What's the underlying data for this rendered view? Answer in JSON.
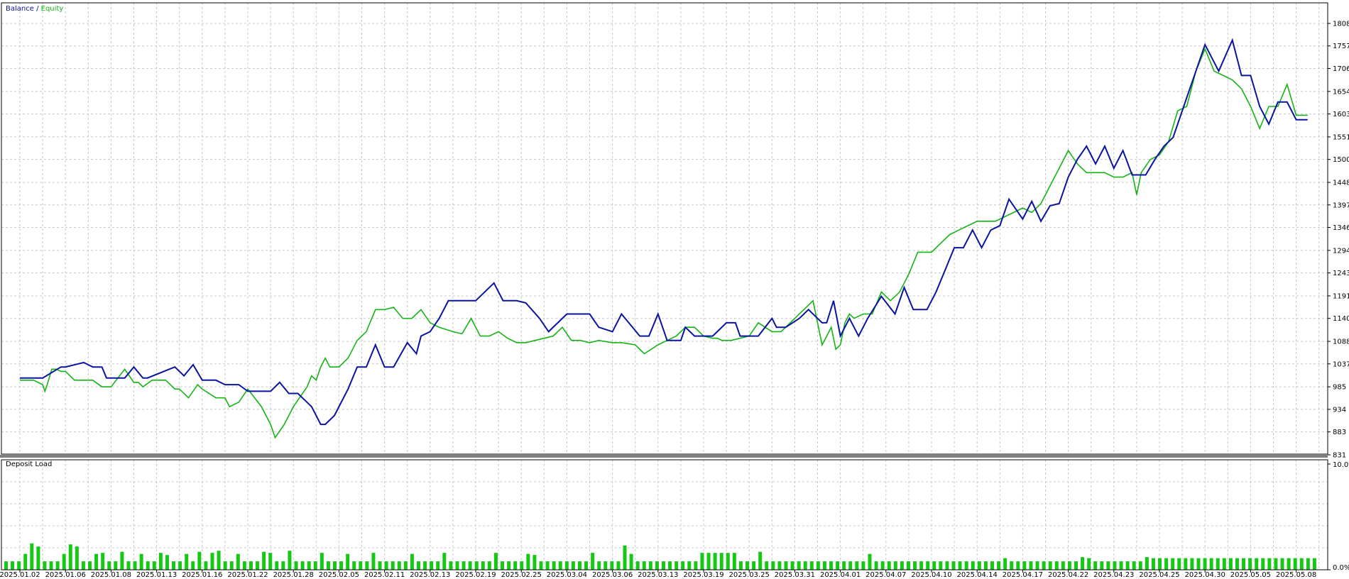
{
  "colors": {
    "balance": "#0a14a0",
    "equity": "#14b414",
    "deposit_bar": "#14c814",
    "grid": "#c8c8c8",
    "frame": "#000000",
    "separator": "#7f7f7f",
    "background": "#ffffff"
  },
  "chart_data": [
    {
      "type": "line",
      "legend": [
        "Balance",
        "Equity"
      ],
      "legend_separator": " / ",
      "legend_placement": "top-left",
      "grid": true,
      "y_axis_side": "right",
      "ylim": [
        831,
        1808
      ],
      "y_ticks": [
        831,
        883,
        934,
        985,
        1037,
        1088,
        1140,
        1191,
        1243,
        1294,
        1346,
        1397,
        1448,
        1500,
        1551,
        1603,
        1654,
        1706,
        1757,
        1808
      ],
      "x_ticks": [
        "2025.01.02",
        "2025.01.06",
        "2025.01.08",
        "2025.01.13",
        "2025.01.16",
        "2025.01.22",
        "2025.01.28",
        "2025.02.05",
        "2025.02.11",
        "2025.02.13",
        "2025.02.19",
        "2025.02.25",
        "2025.03.04",
        "2025.03.06",
        "2025.03.13",
        "2025.03.19",
        "2025.03.25",
        "2025.03.31",
        "2025.04.01",
        "2025.04.07",
        "2025.04.10",
        "2025.04.14",
        "2025.04.17",
        "2025.04.22",
        "2025.04.23",
        "2025.04.25",
        "2025.04.30",
        "2025.05.05",
        "2025.05.08"
      ],
      "series": [
        {
          "name": "Balance",
          "x": [
            0,
            0.5,
            0.9,
            1.0,
            1.4,
            1.6,
            1.8,
            1.9,
            2.3,
            2.5,
            2.7,
            2.8,
            3.4,
            3.6,
            3.8,
            4.0,
            4.3,
            4.5,
            4.8,
            5.0,
            5.5,
            5.7,
            5.9,
            6.1,
            6.4,
            6.6,
            6.7,
            6.9,
            7.2,
            7.4,
            7.6,
            7.8,
            8.0,
            8.2,
            8.5,
            8.7,
            8.8,
            9.0,
            9.2,
            9.4,
            9.6,
            10.0,
            10.4,
            10.6,
            10.9,
            11.1,
            11.4,
            11.6,
            12.0,
            12.5,
            12.7,
            13.0,
            13.2,
            13.6,
            13.8,
            14.0,
            14.2,
            14.5,
            14.6,
            14.8,
            15.2,
            15.5,
            15.7,
            15.8,
            16.2,
            16.5,
            16.6,
            16.8,
            17.1,
            17.3,
            17.6,
            17.7,
            17.85,
            18.0,
            18.2,
            18.4,
            18.6,
            18.9,
            19.2,
            19.4,
            19.6,
            19.9,
            20.1,
            20.3,
            20.5,
            20.7,
            20.9,
            21.1,
            21.3,
            21.5,
            21.7,
            22.0,
            22.2,
            22.4,
            22.6,
            22.8,
            23.0,
            23.2,
            23.4,
            23.6,
            23.8,
            24.0,
            24.2,
            24.4,
            24.7,
            24.9,
            25.1,
            25.3,
            25.6,
            25.8,
            26.0,
            26.3,
            26.6,
            26.8,
            27.0,
            27.2,
            27.4,
            27.6,
            27.8,
            28.0,
            28.25
          ],
          "values": [
            1005,
            1005,
            1030,
            1030,
            1040,
            1030,
            1030,
            1005,
            1005,
            1030,
            1005,
            1005,
            1030,
            1010,
            1035,
            1000,
            1000,
            990,
            990,
            975,
            975,
            995,
            970,
            970,
            940,
            900,
            900,
            920,
            980,
            1030,
            1030,
            1080,
            1030,
            1030,
            1085,
            1060,
            1100,
            1110,
            1140,
            1180,
            1180,
            1180,
            1220,
            1180,
            1180,
            1175,
            1140,
            1110,
            1150,
            1150,
            1120,
            1110,
            1150,
            1100,
            1100,
            1150,
            1090,
            1090,
            1120,
            1100,
            1100,
            1130,
            1130,
            1100,
            1100,
            1140,
            1120,
            1120,
            1140,
            1160,
            1130,
            1130,
            1180,
            1100,
            1140,
            1100,
            1140,
            1190,
            1150,
            1210,
            1160,
            1160,
            1200,
            1250,
            1300,
            1300,
            1340,
            1300,
            1340,
            1350,
            1410,
            1365,
            1405,
            1360,
            1395,
            1400,
            1460,
            1500,
            1530,
            1490,
            1530,
            1480,
            1520,
            1465,
            1465,
            1500,
            1530,
            1550,
            1640,
            1700,
            1760,
            1700,
            1770,
            1690,
            1690,
            1620,
            1580,
            1630,
            1630,
            1590,
            1590
          ]
        },
        {
          "name": "Equity",
          "x": [
            0,
            0.3,
            0.5,
            0.55,
            0.6,
            0.7,
            0.8,
            0.9,
            1.0,
            1.2,
            1.6,
            1.8,
            2.0,
            2.3,
            2.5,
            2.6,
            2.7,
            2.9,
            3.2,
            3.4,
            3.5,
            3.7,
            3.9,
            4.0,
            4.3,
            4.5,
            4.6,
            4.8,
            5.0,
            5.3,
            5.5,
            5.6,
            5.8,
            6.0,
            6.3,
            6.4,
            6.5,
            6.6,
            6.7,
            6.8,
            7.0,
            7.2,
            7.4,
            7.6,
            7.8,
            8.0,
            8.2,
            8.4,
            8.6,
            8.8,
            9.0,
            9.2,
            9.5,
            9.7,
            9.9,
            10.1,
            10.3,
            10.5,
            10.7,
            10.9,
            11.1,
            11.3,
            11.5,
            11.7,
            11.9,
            12.1,
            12.3,
            12.5,
            12.7,
            13.0,
            13.2,
            13.5,
            13.7,
            14.0,
            14.2,
            14.4,
            14.6,
            14.8,
            15.0,
            15.2,
            15.3,
            15.4,
            15.6,
            15.8,
            16.0,
            16.2,
            16.5,
            16.7,
            17.0,
            17.2,
            17.4,
            17.6,
            17.8,
            17.9,
            18.0,
            18.1,
            18.2,
            18.3,
            18.5,
            18.7,
            18.9,
            19.1,
            19.3,
            19.5,
            19.7,
            20.0,
            20.2,
            20.4,
            20.6,
            20.8,
            21.0,
            21.2,
            21.4,
            21.6,
            21.8,
            22.0,
            22.2,
            22.4,
            22.6,
            22.8,
            23.0,
            23.2,
            23.4,
            23.6,
            23.8,
            24.0,
            24.2,
            24.4,
            24.5,
            24.6,
            24.8,
            25.0,
            25.2,
            25.4,
            25.6,
            25.8,
            26.0,
            26.2,
            26.4,
            26.6,
            26.8,
            27.0,
            27.2,
            27.4,
            27.6,
            27.8,
            28.0,
            28.25
          ],
          "values": [
            1000,
            1000,
            990,
            975,
            990,
            1025,
            1025,
            1020,
            1020,
            1000,
            1000,
            985,
            985,
            1025,
            995,
            995,
            985,
            1000,
            1000,
            980,
            980,
            960,
            990,
            980,
            960,
            960,
            940,
            950,
            980,
            940,
            900,
            870,
            900,
            940,
            985,
            1010,
            1000,
            1030,
            1050,
            1030,
            1030,
            1050,
            1090,
            1110,
            1160,
            1160,
            1165,
            1140,
            1140,
            1160,
            1130,
            1120,
            1110,
            1105,
            1140,
            1100,
            1100,
            1110,
            1095,
            1085,
            1085,
            1090,
            1095,
            1100,
            1120,
            1090,
            1090,
            1085,
            1090,
            1085,
            1085,
            1080,
            1060,
            1080,
            1090,
            1100,
            1120,
            1120,
            1100,
            1095,
            1095,
            1090,
            1090,
            1095,
            1100,
            1130,
            1110,
            1110,
            1140,
            1160,
            1180,
            1080,
            1120,
            1070,
            1080,
            1130,
            1150,
            1140,
            1150,
            1150,
            1200,
            1180,
            1200,
            1240,
            1290,
            1290,
            1310,
            1330,
            1340,
            1350,
            1360,
            1360,
            1360,
            1370,
            1380,
            1390,
            1380,
            1400,
            1440,
            1480,
            1520,
            1490,
            1470,
            1470,
            1470,
            1460,
            1460,
            1470,
            1420,
            1470,
            1500,
            1510,
            1540,
            1610,
            1620,
            1700,
            1750,
            1700,
            1690,
            1680,
            1660,
            1620,
            1570,
            1620,
            1620,
            1670,
            1600,
            1600
          ]
        }
      ]
    },
    {
      "type": "bar",
      "title": "Deposit Load",
      "y_axis_side": "right",
      "ylim": [
        0,
        10
      ],
      "y_ticks": [
        "10.0%",
        "0.0%"
      ],
      "unit": "%",
      "values": [
        0.8,
        0.8,
        0.8,
        1.5,
        2.5,
        2.2,
        0.8,
        0.8,
        0.8,
        1.5,
        2.4,
        2.2,
        0.8,
        0.8,
        1.5,
        1.6,
        0.8,
        0.8,
        1.7,
        0.8,
        0.8,
        1.5,
        0.8,
        0.8,
        1.6,
        1.4,
        0.8,
        0.8,
        1.5,
        0.8,
        1.7,
        0.8,
        1.6,
        1.8,
        0.8,
        0.8,
        1.5,
        0.8,
        0.8,
        0.8,
        1.7,
        1.6,
        0.8,
        0.8,
        1.8,
        0.8,
        0.8,
        0.8,
        0.8,
        1.6,
        0.8,
        0.8,
        0.8,
        1.5,
        0.8,
        0.8,
        0.8,
        1.6,
        0.8,
        0.8,
        0.8,
        0.8,
        0.8,
        1.5,
        0.8,
        0.8,
        0.8,
        0.8,
        1.6,
        0.8,
        0.8,
        0.8,
        0.8,
        0.8,
        0.8,
        0.8,
        1.6,
        0.8,
        0.8,
        0.8,
        0.8,
        1.5,
        1.4,
        0.8,
        0.8,
        0.8,
        0.8,
        0.8,
        0.8,
        0.8,
        0.8,
        1.6,
        0.8,
        0.8,
        0.8,
        0.8,
        2.3,
        1.5,
        0.8,
        0.8,
        0.8,
        0.8,
        0.8,
        0.8,
        0.8,
        0.8,
        0.8,
        0.8,
        1.6,
        1.6,
        1.6,
        1.6,
        1.6,
        1.6,
        0.8,
        0.8,
        0.8,
        1.7,
        0.8,
        0.8,
        0.8,
        0.8,
        0.8,
        0.8,
        0.8,
        0.8,
        0.8,
        0.8,
        0.8,
        0.8,
        0.8,
        0.8,
        0.8,
        0.8,
        1.5,
        0.8,
        0.8,
        0.8,
        0.8,
        0.8,
        0.8,
        0.8,
        0.8,
        0.8,
        0.8,
        0.8,
        0.8,
        0.8,
        0.8,
        0.8,
        0.8,
        0.8,
        0.8,
        0.8,
        0.8,
        1.1,
        0.8,
        0.8,
        0.8,
        0.8,
        0.8,
        0.8,
        0.8,
        0.8,
        0.8,
        0.8,
        0.8,
        1.2,
        1.1,
        0.8,
        0.8,
        0.8,
        0.8,
        0.8,
        0.8,
        0.8,
        0.8,
        1.2,
        1.1,
        1.1,
        1.1,
        1.1,
        1.1,
        1.1,
        1.1,
        1.1,
        1.1,
        1.1,
        1.1,
        1.1,
        1.1,
        1.1,
        1.1,
        1.1,
        1.1,
        1.1,
        1.1,
        1.1,
        1.1,
        1.1,
        1.1,
        1.1,
        1.1,
        1.1
      ]
    }
  ]
}
